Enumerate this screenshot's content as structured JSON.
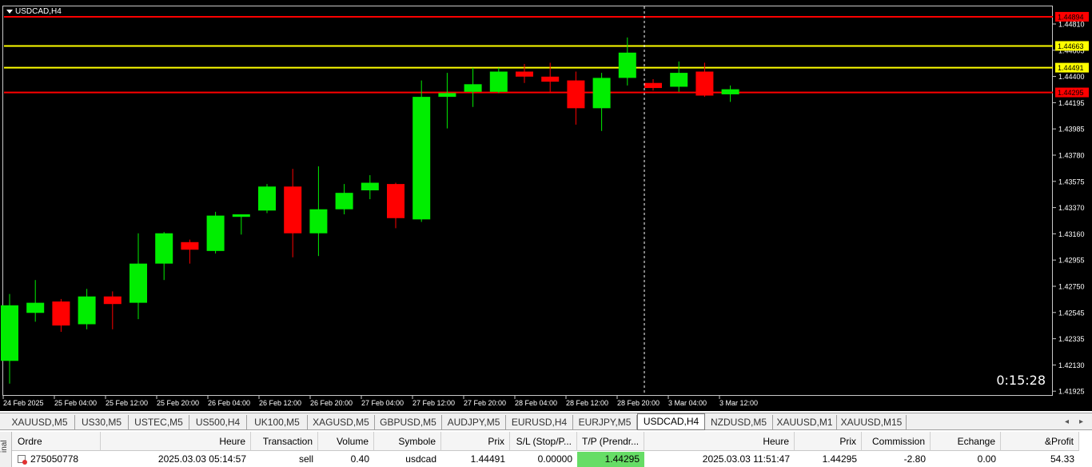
{
  "chart": {
    "title": "USDCAD,H4",
    "countdown": "0:15:28",
    "colors": {
      "bull": "#00ee00",
      "bear": "#ff0000",
      "background": "#000000",
      "axis_text": "#ffffff",
      "level_red": "#ff0000",
      "level_yellow": "#ffff00"
    },
    "price_ticks": [
      "1.44810",
      "1.44605",
      "1.44400",
      "1.44195",
      "1.43985",
      "1.43780",
      "1.43575",
      "1.43370",
      "1.43160",
      "1.42955",
      "1.42750",
      "1.42545",
      "1.42335",
      "1.42130",
      "1.41925"
    ],
    "levels": [
      {
        "price": 1.44894,
        "label": "1.44894",
        "color": "#ff0000"
      },
      {
        "price": 1.44663,
        "label": "1.44663",
        "color": "#ffff00"
      },
      {
        "price": 1.44491,
        "label": "1.44491",
        "color": "#ffff00"
      },
      {
        "price": 1.44295,
        "label": "1.44295",
        "color": "#ff0000"
      }
    ],
    "time_labels": [
      "24 Feb 2025",
      "25 Feb 04:00",
      "25 Feb 12:00",
      "25 Feb 20:00",
      "26 Feb 04:00",
      "26 Feb 12:00",
      "26 Feb 20:00",
      "27 Feb 04:00",
      "27 Feb 12:00",
      "27 Feb 20:00",
      "28 Feb 04:00",
      "28 Feb 12:00",
      "28 Feb 20:00",
      "3 Mar 04:00",
      "3 Mar 12:00"
    ],
    "crosshair_time": "28 Feb 20:00"
  },
  "chart_data": {
    "type": "candlestick",
    "title": "USDCAD,H4",
    "candles": [
      {
        "o": 1.4217,
        "h": 1.427,
        "l": 1.4199,
        "c": 1.4261
      },
      {
        "o": 1.4255,
        "h": 1.4281,
        "l": 1.4248,
        "c": 1.4263
      },
      {
        "o": 1.4264,
        "h": 1.4266,
        "l": 1.424,
        "c": 1.4245
      },
      {
        "o": 1.4246,
        "h": 1.4274,
        "l": 1.4242,
        "c": 1.4268
      },
      {
        "o": 1.4268,
        "h": 1.4272,
        "l": 1.4242,
        "c": 1.4262
      },
      {
        "o": 1.4263,
        "h": 1.4318,
        "l": 1.425,
        "c": 1.4294
      },
      {
        "o": 1.4294,
        "h": 1.4319,
        "l": 1.4281,
        "c": 1.4318
      },
      {
        "o": 1.4311,
        "h": 1.4313,
        "l": 1.4294,
        "c": 1.4305
      },
      {
        "o": 1.4304,
        "h": 1.4335,
        "l": 1.4302,
        "c": 1.4332
      },
      {
        "o": 1.4331,
        "h": 1.4333,
        "l": 1.4317,
        "c": 1.4333
      },
      {
        "o": 1.4336,
        "h": 1.4357,
        "l": 1.4334,
        "c": 1.4355
      },
      {
        "o": 1.4355,
        "h": 1.4369,
        "l": 1.4299,
        "c": 1.4318
      },
      {
        "o": 1.4318,
        "h": 1.4371,
        "l": 1.43,
        "c": 1.4337
      },
      {
        "o": 1.4337,
        "h": 1.4357,
        "l": 1.4333,
        "c": 1.435
      },
      {
        "o": 1.4352,
        "h": 1.4364,
        "l": 1.4345,
        "c": 1.4358
      },
      {
        "o": 1.4357,
        "h": 1.4358,
        "l": 1.4322,
        "c": 1.433
      },
      {
        "o": 1.4329,
        "h": 1.4439,
        "l": 1.4327,
        "c": 1.4426
      },
      {
        "o": 1.4426,
        "h": 1.4445,
        "l": 1.4401,
        "c": 1.4429
      },
      {
        "o": 1.443,
        "h": 1.4449,
        "l": 1.4418,
        "c": 1.4436
      },
      {
        "o": 1.443,
        "h": 1.4449,
        "l": 1.4429,
        "c": 1.4446
      },
      {
        "o": 1.4446,
        "h": 1.4452,
        "l": 1.4437,
        "c": 1.4442
      },
      {
        "o": 1.4442,
        "h": 1.4453,
        "l": 1.443,
        "c": 1.4438
      },
      {
        "o": 1.4439,
        "h": 1.4446,
        "l": 1.4404,
        "c": 1.4417
      },
      {
        "o": 1.4417,
        "h": 1.4445,
        "l": 1.4399,
        "c": 1.4441
      },
      {
        "o": 1.4441,
        "h": 1.4473,
        "l": 1.4435,
        "c": 1.4461
      },
      {
        "o": 1.4437,
        "h": 1.444,
        "l": 1.4431,
        "c": 1.4433
      },
      {
        "o": 1.4434,
        "h": 1.4454,
        "l": 1.443,
        "c": 1.4445
      },
      {
        "o": 1.4446,
        "h": 1.4453,
        "l": 1.4426,
        "c": 1.4427
      },
      {
        "o": 1.4428,
        "h": 1.4435,
        "l": 1.4422,
        "c": 1.4432
      }
    ],
    "ylim": [
      1.41925,
      1.449
    ],
    "grid": false
  },
  "tabs": {
    "items": [
      "XAUUSD,M5",
      "US30,M5",
      "USTEC,M5",
      "US500,H4",
      "UK100,M5",
      "XAGUSD,M5",
      "GBPUSD,M5",
      "AUDJPY,M5",
      "EURUSD,H4",
      "EURJPY,M5",
      "USDCAD,H4",
      "NZDUSD,M5",
      "XAUUSD,M1",
      "XAUUSD,M15"
    ],
    "active": "USDCAD,H4"
  },
  "table": {
    "headers": [
      "Ordre",
      "Heure",
      "Transaction",
      "Volume",
      "Symbole",
      "Prix",
      "S/L (Stop/P...",
      "T/P (Prendr...",
      "Heure",
      "Prix",
      "Commission",
      "Echange",
      "&Profit"
    ],
    "row": [
      "275050778",
      "2025.03.03 05:14:57",
      "sell",
      "0.40",
      "usdcad",
      "1.44491",
      "0.00000",
      "1.44295",
      "2025.03.03 11:51:47",
      "1.44295",
      "-2.80",
      "0.00",
      "54.33"
    ],
    "side_label": "inal"
  }
}
